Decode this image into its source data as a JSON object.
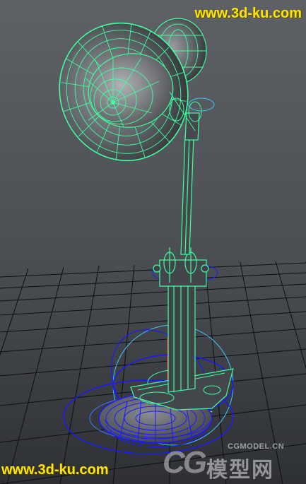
{
  "watermark_top": "www.3d-ku.com",
  "watermark_bottom": "www.3d-ku.com",
  "logo": {
    "mark": "CG",
    "url": "CGMODEL.CN",
    "chinese": "模型网"
  },
  "colors": {
    "background_top": "#5e6166",
    "background_bottom": "#2c2e31",
    "grid": "#0e0f10",
    "wireframe": "#3dffa0",
    "manipulator_blue": "#1a1aff",
    "manipulator_cyan": "#3ec9ff",
    "watermark": "#ffe600"
  }
}
